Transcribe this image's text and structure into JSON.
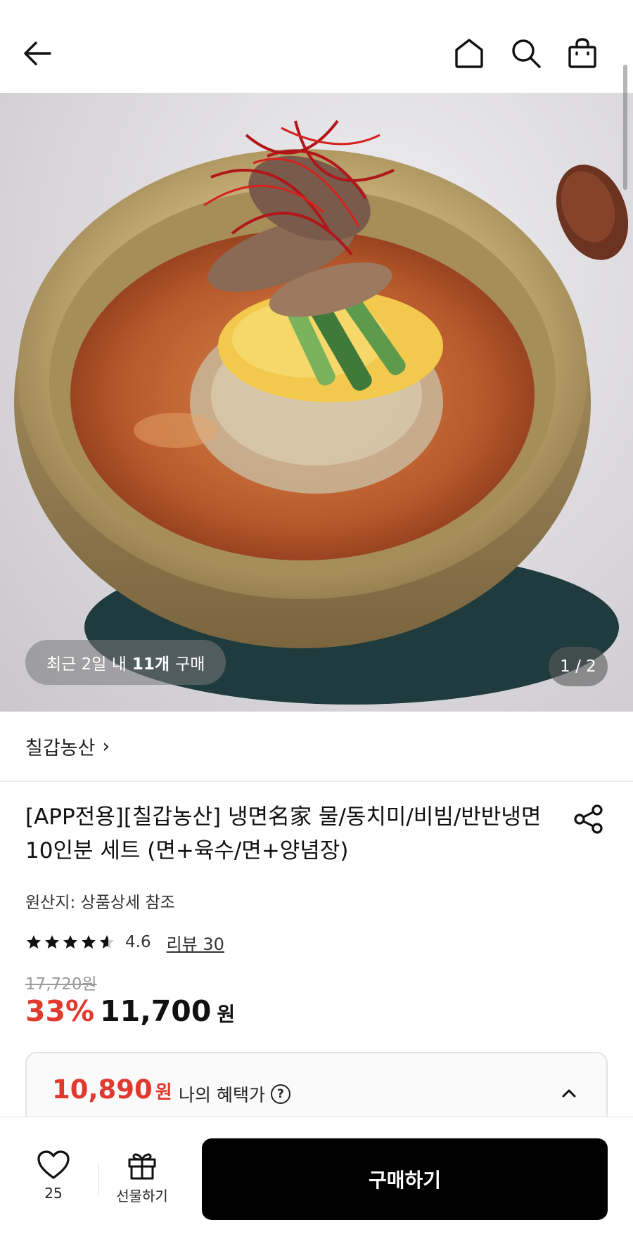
{
  "header": {
    "back_icon": "arrow-left-icon",
    "home_icon": "home-icon",
    "search_icon": "search-icon",
    "cart_icon": "shopping-bag-icon"
  },
  "gallery": {
    "recent_prefix": "최근 2일 내",
    "recent_count": "11개",
    "recent_suffix": "구매",
    "page_indicator": "1 / 2"
  },
  "brand": {
    "name": "칠갑농산",
    "chevron": "›"
  },
  "product": {
    "title": "[APP전용][칠갑농산] 냉면名家 물/동치미/비빔/반반냉면 10인분 세트 (면+육수/면+양념장)",
    "origin": "원산지: 상품상세 참조",
    "rating": "4.6",
    "rating_fraction": 0.92,
    "review_link": "리뷰 30",
    "original_price": "17,720원",
    "discount": "33%",
    "price": "11,700",
    "price_unit": "원"
  },
  "benefit": {
    "amount": "10,890",
    "unit": "원",
    "label": "나의 혜택가",
    "help": "?"
  },
  "bottom_bar": {
    "like_count": "25",
    "gift_label": "선물하기",
    "buy_label": "구매하기"
  },
  "colors": {
    "accent_red": "#e2392f",
    "buy_button": "#000000"
  }
}
